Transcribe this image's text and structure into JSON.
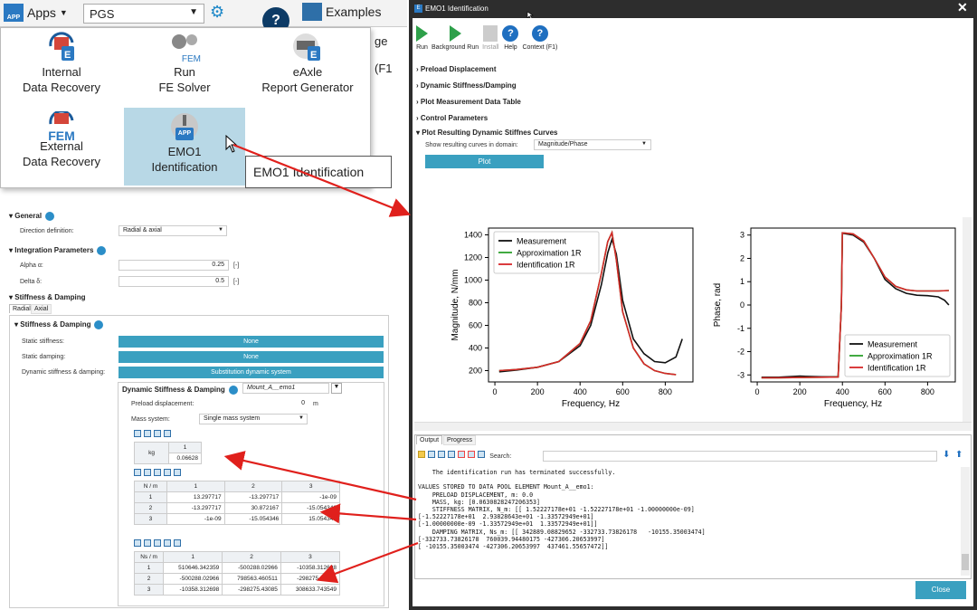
{
  "toolbar": {
    "apps_label": "Apps",
    "app_icon": "APP",
    "project": "PGS",
    "examples_label": "Examples",
    "frag_ge": "ge",
    "frag_f": "(F1"
  },
  "apps_menu": {
    "items": [
      {
        "label": "Internal\nData Recovery"
      },
      {
        "label": "Run\nFE Solver",
        "icon_text": "FEM"
      },
      {
        "label": "eAxle\nReport Generator"
      },
      {
        "label": "External\nData Recovery",
        "icon_text": "FEM"
      },
      {
        "label": "EMO1\nIdentification",
        "icon_text": "APP"
      }
    ],
    "tooltip": "EMO1 Identification"
  },
  "props": {
    "general": "General",
    "direction_label": "Direction definition:",
    "direction_value": "Radial & axial",
    "integration": "Integration Parameters",
    "alpha_label": "Alpha α:",
    "alpha_value": "0.25",
    "alpha_unit": "[-]",
    "delta_label": "Delta δ:",
    "delta_value": "0.5",
    "delta_unit": "[-]",
    "stiff_damp": "Stiffness & Damping",
    "tab_radial": "Radial",
    "tab_axial": "Axial",
    "stiff_damp_inner": "Stiffness & Damping",
    "static_stiff_label": "Static stiffness:",
    "static_stiff_value": "None",
    "static_damp_label": "Static damping:",
    "static_damp_value": "None",
    "dyn_label": "Dynamic stiffness & damping:",
    "dyn_value": "Substitution dynamic system",
    "dsd_title": "Dynamic Stiffness & Damping",
    "dsd_element": "Mount_A__emo1",
    "preload_label": "Preload displacement:",
    "preload_value": "0",
    "preload_unit": "m",
    "mass_label": "Mass system:",
    "mass_value": "Single mass system",
    "mass_table": {
      "unit": "kg",
      "col": "1",
      "value": "0.06628"
    },
    "stiff_table": {
      "unit": "N / m",
      "cols": [
        "1",
        "2",
        "3"
      ],
      "rows": [
        [
          "1",
          "13.297717",
          "-13.297717",
          "-1e-09"
        ],
        [
          "2",
          "-13.297717",
          "30.872167",
          "-15.054346"
        ],
        [
          "3",
          "-1e-09",
          "-15.054346",
          "15.054346"
        ]
      ]
    },
    "damp_table": {
      "unit": "Ns / m",
      "cols": [
        "1",
        "2",
        "3"
      ],
      "rows": [
        [
          "1",
          "510646.342359",
          "-500288.02966",
          "-10358.312698"
        ],
        [
          "2",
          "-500288.02966",
          "798563.460511",
          "-298275.43085"
        ],
        [
          "3",
          "-10358.312698",
          "-298275.43085",
          "308633.743549"
        ]
      ]
    }
  },
  "dialog": {
    "title": "EMO1 Identification",
    "toolbar": [
      "Run",
      "Background Run",
      "Install",
      "Help",
      "Context (F1)"
    ],
    "tree": [
      "Preload Displacement",
      "Dynamic Stiffness/Damping",
      "Plot Measurement Data Table",
      "Control Parameters",
      "Plot Resulting Dynamic Stiffnes Curves"
    ],
    "domain_label": "Show resulting curves in domain:",
    "domain_value": "Magnitude/Phase",
    "plot_button": "Plot",
    "output_tabs": [
      "Output",
      "Progress"
    ],
    "search_label": "Search:",
    "output_text": "    The identification run has terminated successfully.\n\nVALUES STORED TO DATA POOL ELEMENT Mount_A__emo1:\n    PRELOAD DISPLACEMENT, m: 0.0\n    MASS, kg: [0.0630828247206353]\n    STIFFNESS MATRIX, N_m: [[ 1.52227178e+01 -1.52227178e+01 -1.00000000e-09]\n[-1.52227178e+01  2.93828643e+01 -1.33572949e+01]\n[-1.00000000e-09 -1.33572949e+01  1.33572949e+01]]\n    DAMPING MATRIX, Ns_m: [[ 342889.08829652 -332733.73826178   -10155.35003474]\n[-332733.73826178  760039.94480175 -427306.20653997]\n[ -10155.35003474 -427306.20653997  437461.55657472]]",
    "close": "Close"
  },
  "colors": {
    "measurement": "#111111",
    "approximation": "#2ca02c",
    "identification": "#d62728",
    "accent": "#3aa0c0"
  },
  "chart_data": [
    {
      "type": "line",
      "xlabel": "Frequency, Hz",
      "ylabel": "Magnitude, N/mm",
      "xlim": [
        -30,
        930
      ],
      "ylim": [
        100,
        1460
      ],
      "xticks": [
        0,
        200,
        400,
        600,
        800
      ],
      "yticks": [
        200,
        400,
        600,
        800,
        1000,
        1200,
        1400
      ],
      "legend": "top-left",
      "series": [
        {
          "name": "Measurement",
          "x": [
            20,
            100,
            200,
            300,
            400,
            450,
            500,
            530,
            550,
            570,
            600,
            650,
            700,
            750,
            800,
            850,
            880
          ],
          "y": [
            190,
            205,
            230,
            280,
            420,
            600,
            960,
            1240,
            1360,
            1230,
            820,
            480,
            350,
            280,
            270,
            320,
            480
          ]
        },
        {
          "name": "Approximation 1R",
          "x": [
            20,
            100,
            200,
            300,
            400,
            450,
            500,
            530,
            550,
            570,
            600,
            650,
            700,
            750,
            800,
            850
          ],
          "y": [
            200,
            210,
            230,
            280,
            440,
            640,
            1060,
            1340,
            1420,
            1180,
            720,
            400,
            260,
            200,
            175,
            165
          ]
        },
        {
          "name": "Identification 1R",
          "x": [
            20,
            100,
            200,
            300,
            400,
            450,
            500,
            530,
            550,
            570,
            600,
            650,
            700,
            750,
            800,
            850
          ],
          "y": [
            200,
            210,
            230,
            280,
            440,
            640,
            1060,
            1340,
            1420,
            1180,
            720,
            400,
            260,
            200,
            175,
            165
          ]
        }
      ]
    },
    {
      "type": "line",
      "xlabel": "Frequency, Hz",
      "ylabel": "Phase, rad",
      "xlim": [
        -30,
        930
      ],
      "ylim": [
        -3.3,
        3.3
      ],
      "xticks": [
        0,
        200,
        400,
        600,
        800
      ],
      "yticks": [
        -3,
        -2,
        -1,
        0,
        1,
        2,
        3
      ],
      "legend": "bottom-right",
      "series": [
        {
          "name": "Measurement",
          "x": [
            20,
            100,
            200,
            300,
            380,
            395,
            400,
            450,
            500,
            550,
            600,
            650,
            700,
            750,
            800,
            850,
            880,
            900
          ],
          "y": [
            -3.1,
            -3.1,
            -3.05,
            -3.08,
            -3.08,
            0.0,
            3.08,
            3.0,
            2.7,
            2.0,
            1.1,
            0.7,
            0.5,
            0.42,
            0.4,
            0.35,
            0.2,
            0.0
          ]
        },
        {
          "name": "Approximation 1R",
          "x": [
            20,
            100,
            200,
            300,
            380,
            395,
            400,
            450,
            500,
            550,
            600,
            650,
            700,
            750,
            800,
            850,
            900
          ],
          "y": [
            -3.12,
            -3.12,
            -3.11,
            -3.1,
            -3.09,
            0.0,
            3.1,
            3.05,
            2.75,
            2.0,
            1.2,
            0.8,
            0.65,
            0.6,
            0.6,
            0.6,
            0.62
          ]
        },
        {
          "name": "Identification 1R",
          "x": [
            20,
            100,
            200,
            300,
            380,
            395,
            400,
            450,
            500,
            550,
            600,
            650,
            700,
            750,
            800,
            850,
            900
          ],
          "y": [
            -3.12,
            -3.12,
            -3.11,
            -3.1,
            -3.09,
            0.0,
            3.1,
            3.05,
            2.75,
            2.0,
            1.2,
            0.8,
            0.65,
            0.6,
            0.6,
            0.6,
            0.62
          ]
        }
      ]
    }
  ]
}
